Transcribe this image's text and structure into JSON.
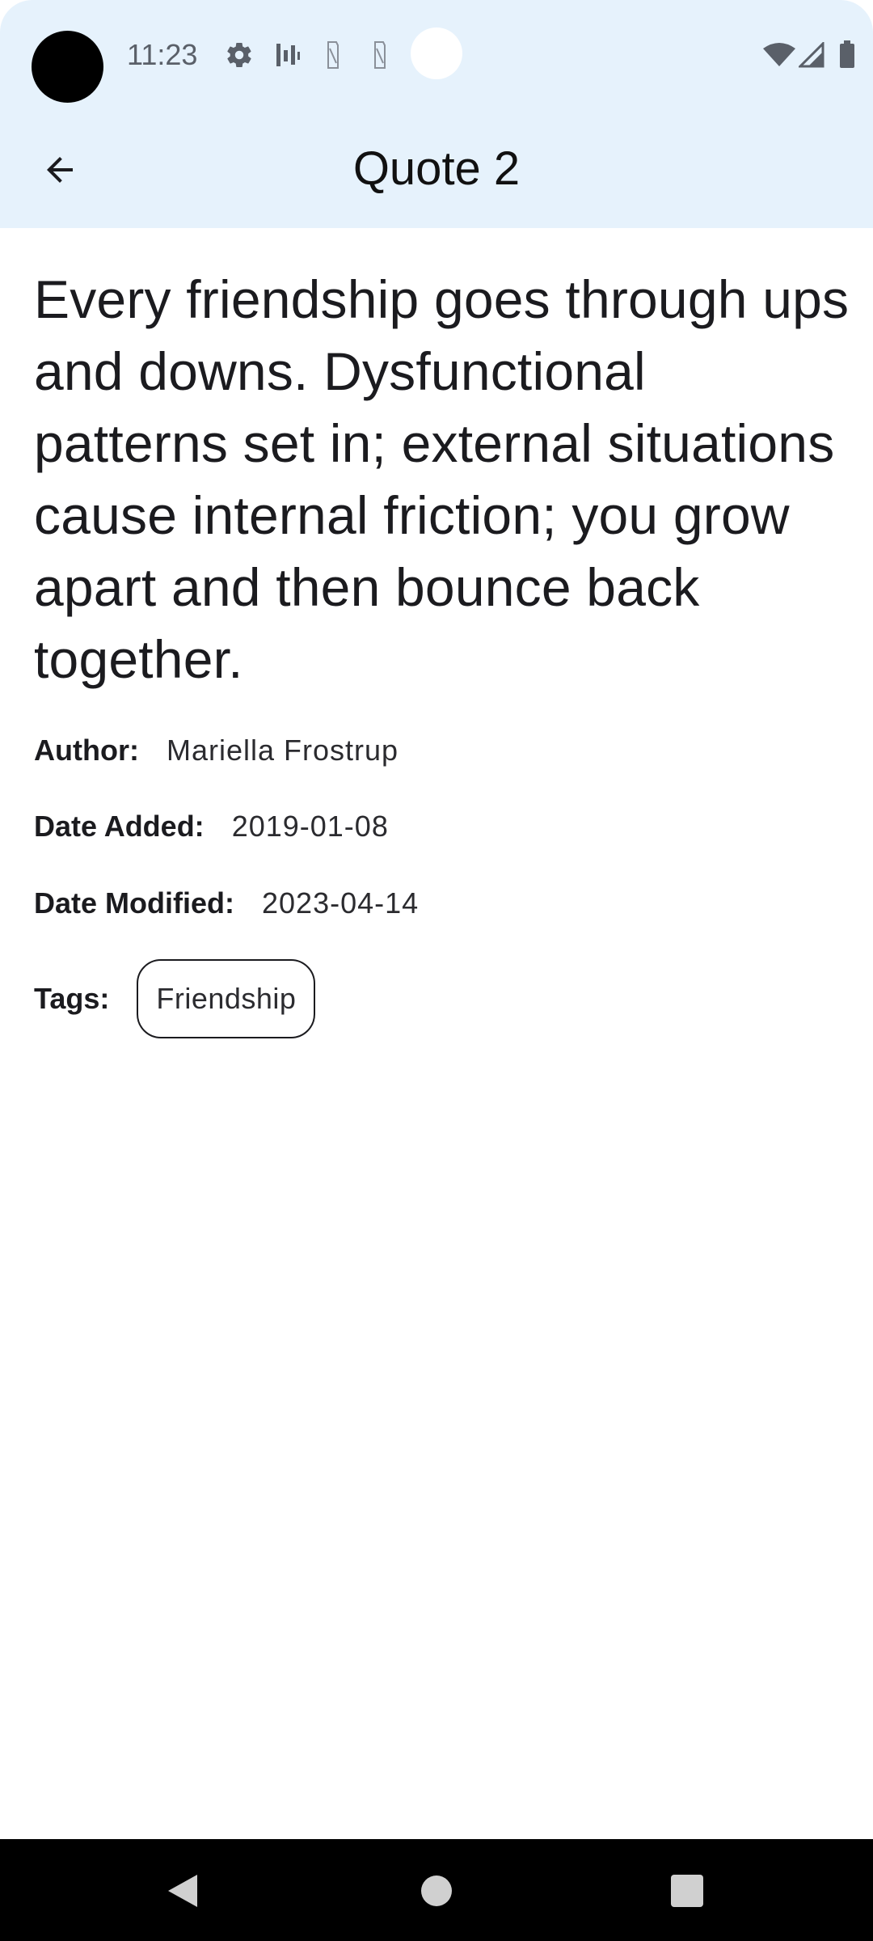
{
  "status_bar": {
    "time": "11:23",
    "icons": [
      "camera-cutout",
      "gear-icon",
      "activity-bars-icon",
      "sim-icon",
      "sim-icon",
      "notification-dot",
      "wifi-icon",
      "cell-signal-icon",
      "battery-icon"
    ]
  },
  "app_bar": {
    "title": "Quote 2",
    "back_icon": "arrow-back-icon"
  },
  "quote": {
    "text": "Every friendship goes through ups and downs. Dysfunctional patterns set in; external situations cause internal friction; you grow apart and then bounce back together.",
    "author_label": "Author:",
    "author": "Mariella Frostrup",
    "date_added_label": "Date Added:",
    "date_added": "2019-01-08",
    "date_modified_label": "Date Modified:",
    "date_modified": "2023-04-14",
    "tags_label": "Tags:",
    "tags": [
      "Friendship"
    ]
  },
  "nav_bar": {
    "icons": [
      "nav-back-icon",
      "nav-home-icon",
      "nav-recents-icon"
    ]
  },
  "colors": {
    "header_background": "#e6f2fc",
    "text": "#1b1b1f",
    "nav_bar": "#000000"
  }
}
